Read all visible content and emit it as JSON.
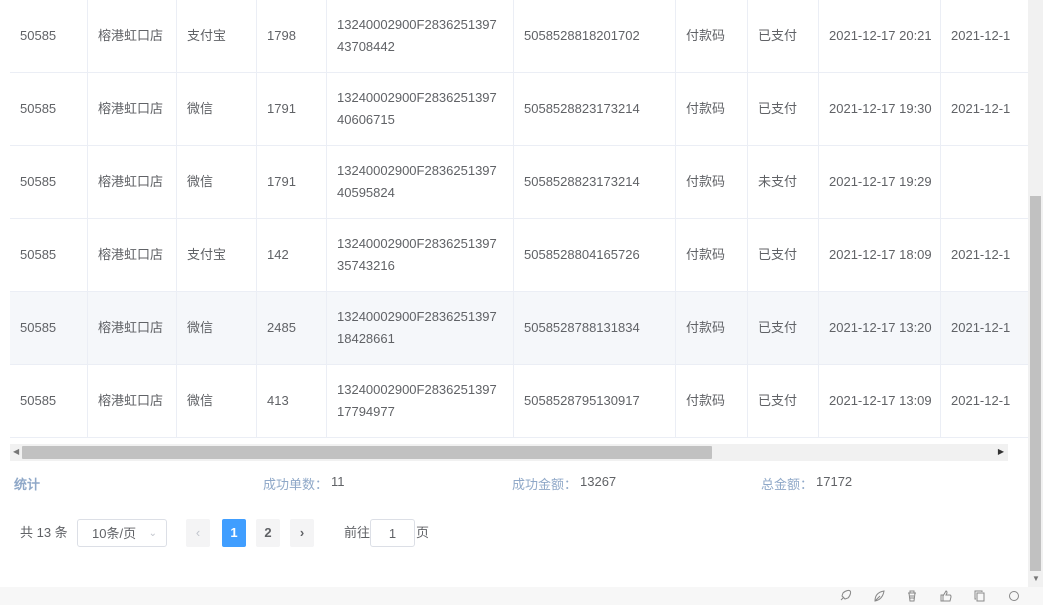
{
  "table": {
    "rows": [
      {
        "store_id": "50585",
        "store": "榕港虹口店",
        "channel": "支付宝",
        "amount": "1798",
        "trade_no": "13240002900F283625139743708442",
        "order_no": "5058528818201702",
        "method": "付款码",
        "status": "已支付",
        "created": "2021-12-17 20:21",
        "paid": "2021-12-1",
        "hover": false
      },
      {
        "store_id": "50585",
        "store": "榕港虹口店",
        "channel": "微信",
        "amount": "1791",
        "trade_no": "13240002900F283625139740606715",
        "order_no": "5058528823173214",
        "method": "付款码",
        "status": "已支付",
        "created": "2021-12-17 19:30",
        "paid": "2021-12-1",
        "hover": false
      },
      {
        "store_id": "50585",
        "store": "榕港虹口店",
        "channel": "微信",
        "amount": "1791",
        "trade_no": "13240002900F283625139740595824",
        "order_no": "5058528823173214",
        "method": "付款码",
        "status": "未支付",
        "created": "2021-12-17 19:29",
        "paid": "",
        "hover": false
      },
      {
        "store_id": "50585",
        "store": "榕港虹口店",
        "channel": "支付宝",
        "amount": "142",
        "trade_no": "13240002900F283625139735743216",
        "order_no": "5058528804165726",
        "method": "付款码",
        "status": "已支付",
        "created": "2021-12-17 18:09",
        "paid": "2021-12-1",
        "hover": false
      },
      {
        "store_id": "50585",
        "store": "榕港虹口店",
        "channel": "微信",
        "amount": "2485",
        "trade_no": "13240002900F283625139718428661",
        "order_no": "5058528788131834",
        "method": "付款码",
        "status": "已支付",
        "created": "2021-12-17 13:20",
        "paid": "2021-12-1",
        "hover": true
      },
      {
        "store_id": "50585",
        "store": "榕港虹口店",
        "channel": "微信",
        "amount": "413",
        "trade_no": "13240002900F283625139717794977",
        "order_no": "5058528795130917",
        "method": "付款码",
        "status": "已支付",
        "created": "2021-12-17 13:09",
        "paid": "2021-12-1",
        "hover": false
      }
    ]
  },
  "stats": {
    "title": "统计",
    "success_count_label": "成功单数：",
    "success_count_value": "11",
    "success_amount_label": "成功金额：",
    "success_amount_value": "13267",
    "total_amount_label": "总金额：",
    "total_amount_value": "17172"
  },
  "pagination": {
    "total": "共 13 条",
    "page_size": "10条/页",
    "pages": [
      "1",
      "2"
    ],
    "current": "1",
    "goto_label": "前往",
    "goto_value": "1",
    "page_word": "页"
  },
  "icons": {
    "toolbar": [
      "rocket-icon",
      "leaf-icon",
      "trash-icon",
      "thumb-icon",
      "copy-icon",
      "circle-icon"
    ]
  }
}
